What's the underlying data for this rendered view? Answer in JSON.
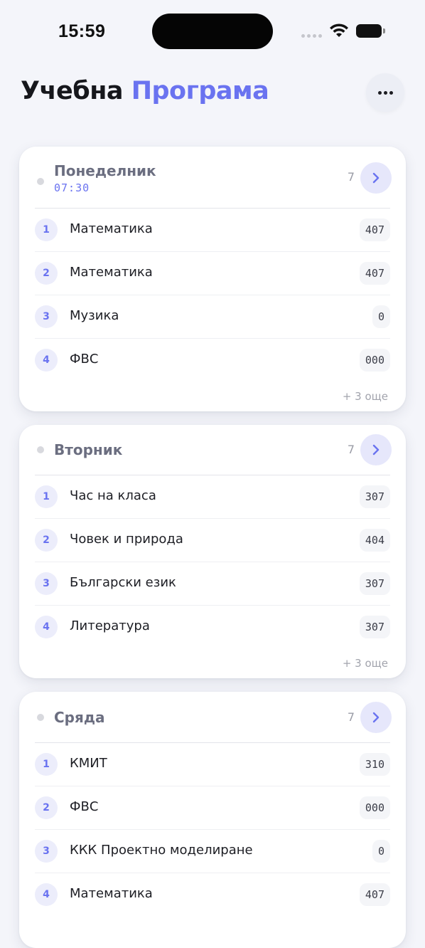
{
  "status": {
    "time": "15:59"
  },
  "header": {
    "title_part1": "Учебна",
    "title_part2": "Програма",
    "more_icon": "ellipsis-icon"
  },
  "days": [
    {
      "name": "Понеделник",
      "start_time": "07:30",
      "count": "7",
      "lessons": [
        {
          "n": "1",
          "subject": "Математика",
          "room": "407"
        },
        {
          "n": "2",
          "subject": "Математика",
          "room": "407"
        },
        {
          "n": "3",
          "subject": "Музика",
          "room": "0"
        },
        {
          "n": "4",
          "subject": "ФВС",
          "room": "000"
        }
      ],
      "more": "+ 3 още"
    },
    {
      "name": "Вторник",
      "count": "7",
      "lessons": [
        {
          "n": "1",
          "subject": "Час на класа",
          "room": "307"
        },
        {
          "n": "2",
          "subject": "Човек и природа",
          "room": "404"
        },
        {
          "n": "3",
          "subject": "Български език",
          "room": "307"
        },
        {
          "n": "4",
          "subject": "Литература",
          "room": "307"
        }
      ],
      "more": "+ 3 още"
    },
    {
      "name": "Сряда",
      "count": "7",
      "lessons": [
        {
          "n": "1",
          "subject": "КМИТ",
          "room": "310"
        },
        {
          "n": "2",
          "subject": "ФВС",
          "room": "000"
        },
        {
          "n": "3",
          "subject": "ККК Проектно моделиране",
          "room": "0"
        },
        {
          "n": "4",
          "subject": "Математика",
          "room": "407"
        }
      ]
    }
  ]
}
